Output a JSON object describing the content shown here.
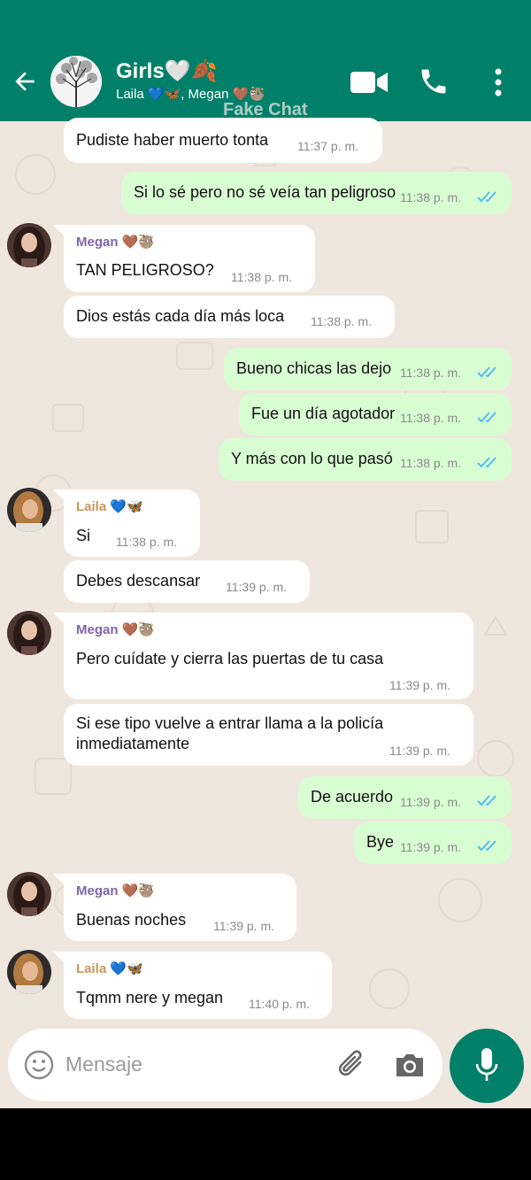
{
  "header": {
    "title": "Girls🤍🍂",
    "subtitle": "Laila 💙🦋, Megan 🤎🦥",
    "watermark": "Fake Chat"
  },
  "colors": {
    "header": "#008069",
    "outgoing": "#d9fdd3",
    "incoming": "#ffffff",
    "ticks": "#53bdeb",
    "megan_name": "#7f66a8",
    "laila_name": "#c8965c"
  },
  "messages": [
    {
      "dir": "in",
      "text": "Pudiste haber muerto tonta",
      "time": "11:37 p. m."
    },
    {
      "dir": "out",
      "text": "Si lo sé pero no sé veía tan peligroso",
      "time": "11:38 p. m."
    },
    {
      "dir": "in",
      "sender": "Megan 🤎🦥",
      "text": "TAN PELIGROSO?",
      "time": "11:38 p. m."
    },
    {
      "dir": "in",
      "text": "Dios estás cada día más loca",
      "time": "11:38 p. m."
    },
    {
      "dir": "out",
      "text": "Bueno chicas las dejo",
      "time": "11:38 p. m."
    },
    {
      "dir": "out",
      "text": "Fue un día agotador",
      "time": "11:38 p. m."
    },
    {
      "dir": "out",
      "text": "Y más con lo que pasó",
      "time": "11:38 p. m."
    },
    {
      "dir": "in",
      "sender": "Laila 💙🦋",
      "text": "Si",
      "time": "11:38 p. m."
    },
    {
      "dir": "in",
      "text": "Debes descansar",
      "time": "11:39 p. m."
    },
    {
      "dir": "in",
      "sender": "Megan 🤎🦥",
      "text": "Pero cuídate y cierra las puertas de tu casa",
      "time": "11:39 p. m."
    },
    {
      "dir": "in",
      "text_line1": "Si ese tipo vuelve a entrar llama a la policía",
      "text_line2": "inmediatamente",
      "time": "11:39 p. m."
    },
    {
      "dir": "out",
      "text": "De acuerdo",
      "time": "11:39 p. m."
    },
    {
      "dir": "out",
      "text": "Bye",
      "time": "11:39 p. m."
    },
    {
      "dir": "in",
      "sender": "Megan 🤎🦥",
      "text": "Buenas noches",
      "time": "11:39 p. m."
    },
    {
      "dir": "in",
      "sender": "Laila 💙🦋",
      "text": "Tqmm nere y megan",
      "time": "11:40 p. m."
    }
  ],
  "composer": {
    "placeholder": "Mensaje"
  }
}
